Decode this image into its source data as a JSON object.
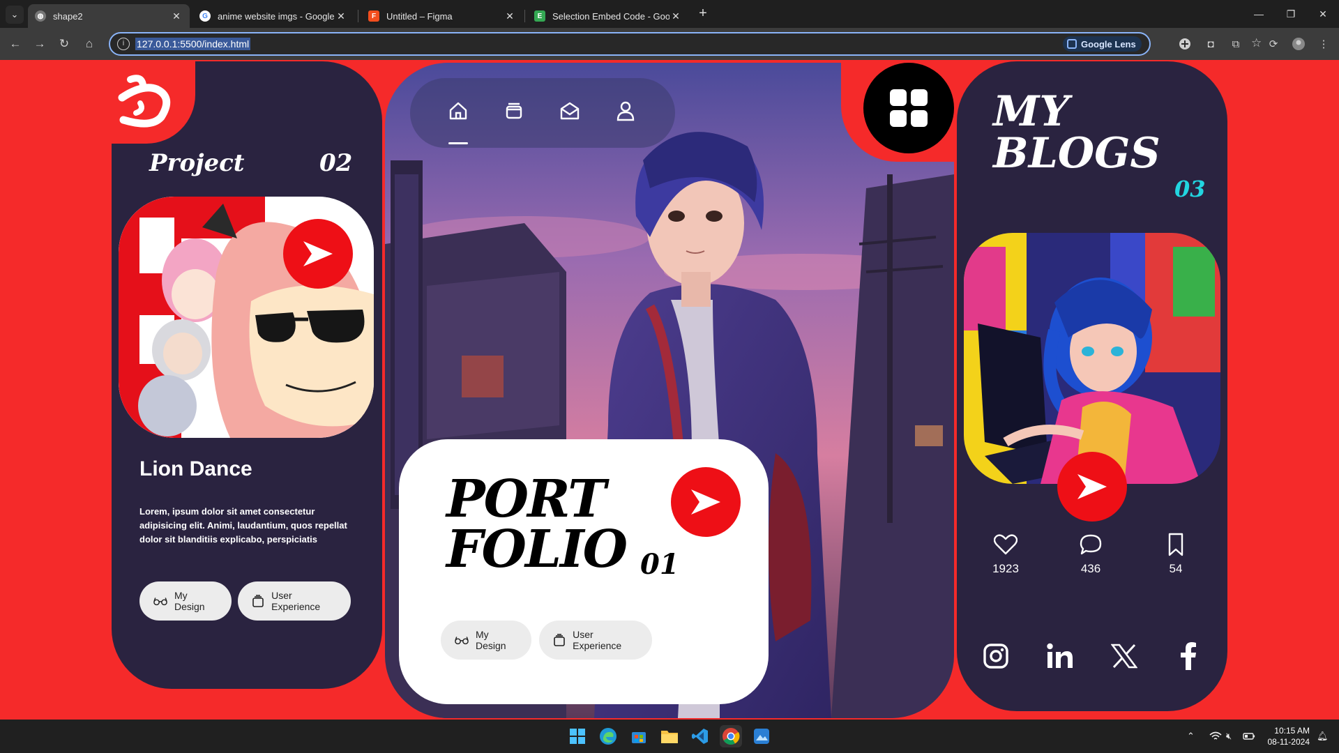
{
  "browser": {
    "tabs": [
      {
        "title": "shape2",
        "active": true
      },
      {
        "title": "anime website imgs - Google Se"
      },
      {
        "title": "Untitled – Figma"
      },
      {
        "title": "Selection Embed Code - Googl"
      }
    ],
    "url": "127.0.0.1:5500/index.html",
    "lens_label": "Google Lens"
  },
  "project_card": {
    "title": "Project",
    "number": "02",
    "heading": "Lion Dance",
    "description": "Lorem, ipsum dolor sit amet consectetur adipisicing elit. Animi, laudantium, quos repellat dolor sit blanditiis explicabo, perspiciatis",
    "buttons": [
      {
        "label": "My Design",
        "icon": "glasses-icon"
      },
      {
        "label": "User Experience",
        "icon": "layers-icon"
      }
    ]
  },
  "hero": {
    "nav_icons": [
      "home-icon",
      "bag-icon",
      "mail-icon",
      "user-icon"
    ],
    "portfolio_line1": "PORT",
    "portfolio_line2": "FOLIO",
    "portfolio_number": "01",
    "buttons": [
      {
        "label": "My Design",
        "icon": "glasses-icon"
      },
      {
        "label": "User Experience",
        "icon": "layers-icon"
      }
    ]
  },
  "blogs_card": {
    "title_line1": "MY",
    "title_line2": "BLOGS",
    "number": "03",
    "stats": [
      {
        "icon": "heart-icon",
        "value": "1923"
      },
      {
        "icon": "comment-icon",
        "value": "436"
      },
      {
        "icon": "bookmark-icon",
        "value": "54"
      }
    ],
    "socials": [
      "instagram-icon",
      "linkedin-icon",
      "x-icon",
      "facebook-icon"
    ]
  },
  "taskbar": {
    "time": "10:15 AM",
    "date": "08-11-2024"
  },
  "colors": {
    "background_red": "#f52a2a",
    "card_dark": "#2a2340",
    "accent_red": "#ee0f16",
    "accent_cyan": "#22d5e0"
  }
}
